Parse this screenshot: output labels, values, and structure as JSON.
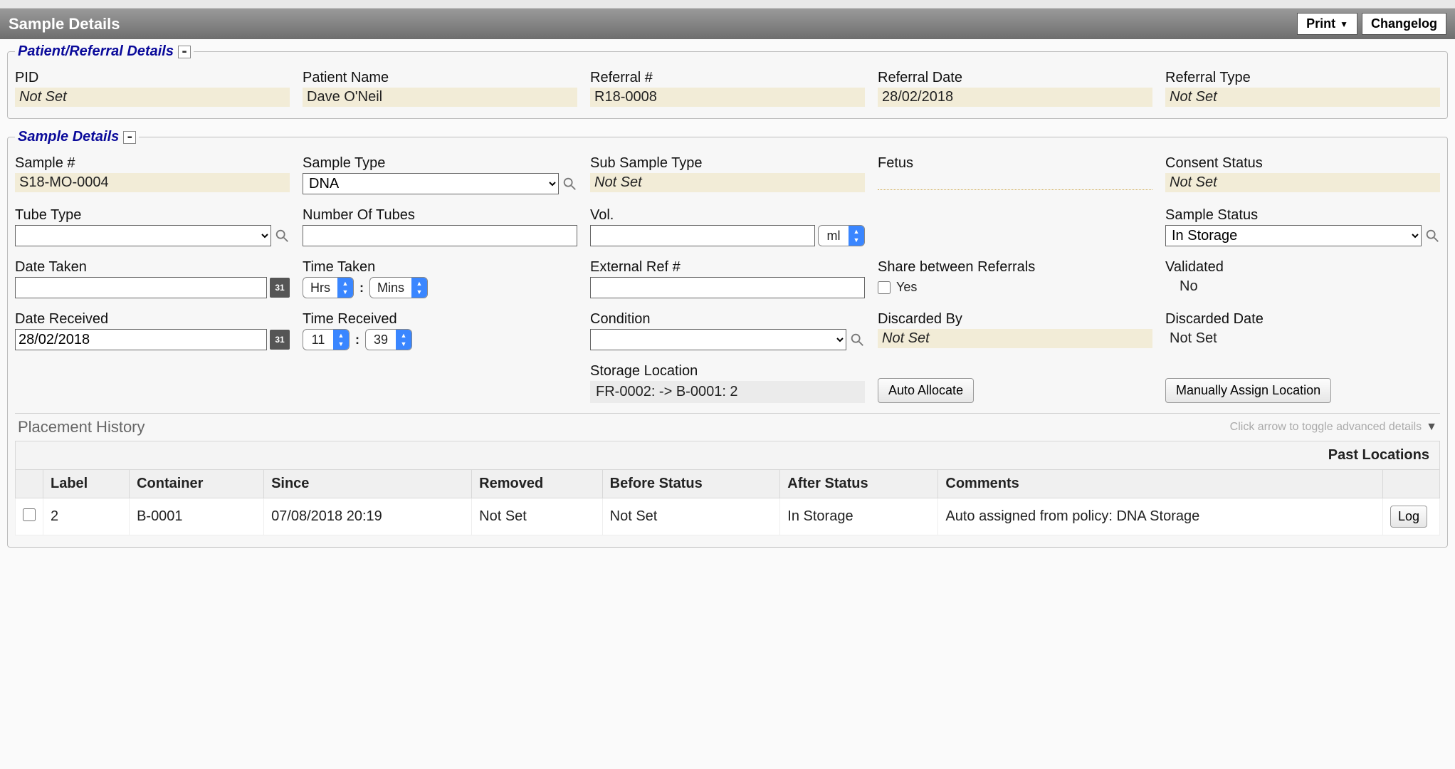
{
  "header": {
    "title": "Sample Details",
    "print_label": "Print",
    "changelog_label": "Changelog"
  },
  "patient_section": {
    "legend": "Patient/Referral Details",
    "fields": {
      "pid": {
        "label": "PID",
        "value": "Not Set",
        "notset": true
      },
      "patient_name": {
        "label": "Patient Name",
        "value": "Dave O'Neil"
      },
      "referral_no": {
        "label": "Referral #",
        "value": "R18-0008"
      },
      "referral_date": {
        "label": "Referral Date",
        "value": "28/02/2018"
      },
      "referral_type": {
        "label": "Referral Type",
        "value": "Not Set",
        "notset": true
      }
    }
  },
  "sample_section": {
    "legend": "Sample Details",
    "row1": {
      "sample_no": {
        "label": "Sample #",
        "value": "S18-MO-0004"
      },
      "sample_type": {
        "label": "Sample Type",
        "value": "DNA"
      },
      "sub_sample_type": {
        "label": "Sub Sample Type",
        "value": "Not Set",
        "notset": true
      },
      "fetus": {
        "label": "Fetus"
      },
      "consent_status": {
        "label": "Consent Status",
        "value": "Not Set",
        "notset": true
      }
    },
    "row2": {
      "tube_type": {
        "label": "Tube Type",
        "value": ""
      },
      "num_tubes": {
        "label": "Number Of Tubes",
        "value": ""
      },
      "vol": {
        "label": "Vol.",
        "value": "",
        "unit": "ml"
      },
      "sample_status": {
        "label": "Sample Status",
        "value": "In Storage"
      }
    },
    "row3": {
      "date_taken": {
        "label": "Date Taken",
        "value": ""
      },
      "time_taken": {
        "label": "Time Taken",
        "hrs": "Hrs",
        "mins": "Mins"
      },
      "ext_ref": {
        "label": "External Ref #",
        "value": ""
      },
      "share": {
        "label": "Share between Referrals",
        "yes_label": "Yes",
        "checked": false
      },
      "validated": {
        "label": "Validated",
        "value": "No"
      }
    },
    "row4": {
      "date_received": {
        "label": "Date Received",
        "value": "28/02/2018"
      },
      "time_received": {
        "label": "Time Received",
        "hrs": "11",
        "mins": "39"
      },
      "condition": {
        "label": "Condition",
        "value": ""
      },
      "discarded_by": {
        "label": "Discarded By",
        "value": "Not Set",
        "notset": true
      },
      "discarded_date": {
        "label": "Discarded Date",
        "value": "Not Set"
      }
    },
    "row5": {
      "storage_location": {
        "label": "Storage Location",
        "value": "FR-0002:    -> B-0001: 2"
      },
      "auto_allocate": "Auto Allocate",
      "manual_assign": "Manually Assign Location"
    }
  },
  "placement": {
    "title": "Placement History",
    "hint": "Click arrow to toggle advanced details",
    "past_locations_label": "Past Locations",
    "columns": [
      "Label",
      "Container",
      "Since",
      "Removed",
      "Before Status",
      "After Status",
      "Comments"
    ],
    "rows": [
      {
        "label": "2",
        "container": "B-0001",
        "since": "07/08/2018 20:19",
        "removed": "Not Set",
        "before": "Not Set",
        "after": "In Storage",
        "comments": "Auto assigned from policy: DNA Storage",
        "log_btn": "Log"
      }
    ]
  }
}
